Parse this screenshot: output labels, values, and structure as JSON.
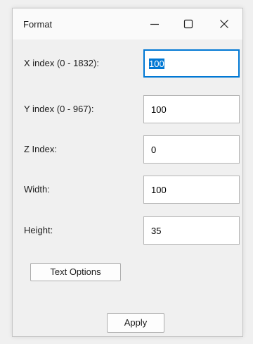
{
  "window": {
    "title": "Format",
    "controls": {
      "minimize": "minimize-icon",
      "maximize": "maximize-icon",
      "close": "close-icon"
    }
  },
  "fields": [
    {
      "label": "X index (0 - 1832):",
      "value": "100",
      "focused": true
    },
    {
      "label": "Y index (0 - 967):",
      "value": "100"
    },
    {
      "label": "Z Index:",
      "value": "0"
    },
    {
      "label": "Width:",
      "value": "100"
    },
    {
      "label": "Height:",
      "value": "35"
    }
  ],
  "buttons": {
    "text_options": "Text Options",
    "apply": "Apply"
  },
  "colors": {
    "accent": "#0078d4",
    "background": "#f0f0f0"
  }
}
